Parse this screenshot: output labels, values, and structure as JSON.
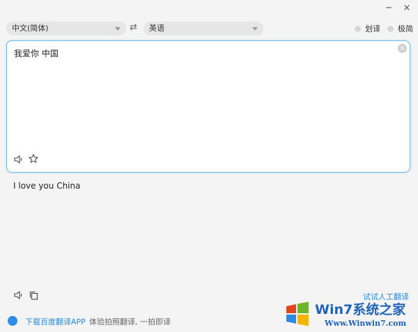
{
  "window": {
    "minimize": "−",
    "close": "×"
  },
  "languages": {
    "source": "中文(简体)",
    "target": "英语",
    "swap": "⇄"
  },
  "options": {
    "highlight_label": "划译",
    "minimal_label": "极简"
  },
  "input": {
    "text": "我爱你 中国",
    "clear": "×"
  },
  "output": {
    "text": "I love you China",
    "human_translate": "试试人工翻译"
  },
  "footer": {
    "app_link": "下载百度翻译APP",
    "app_desc": "体验拍照翻译, 一拍即译"
  },
  "watermark": {
    "brand": "Win7系统之家",
    "url": "Www.Winwin7.com"
  },
  "colors": {
    "accent": "#2a8ad6",
    "border": "#6db9e8"
  }
}
